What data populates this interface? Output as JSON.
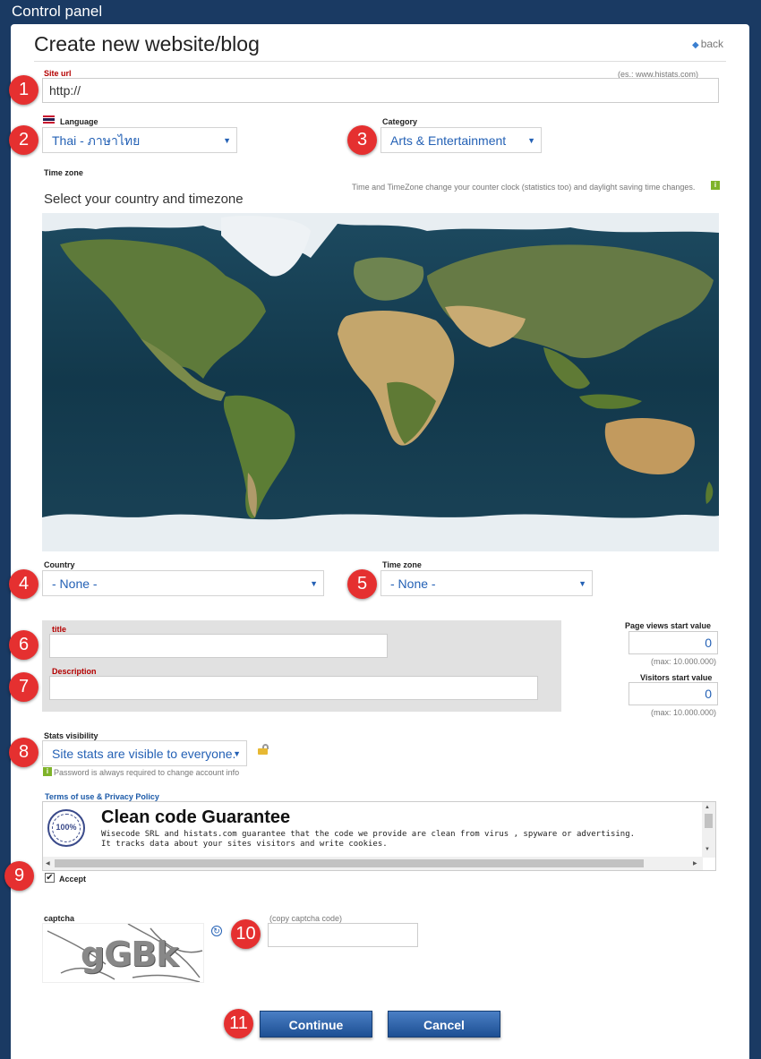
{
  "window": {
    "title": "Control panel"
  },
  "page": {
    "title": "Create new website/blog",
    "back_label": "back"
  },
  "site_url": {
    "label": "Site url",
    "example": "(es.: www.histats.com)",
    "value": "http://"
  },
  "language": {
    "label": "Language",
    "selected": "Thai - ภาษาไทย",
    "flag_icon": "thai-flag-icon"
  },
  "category": {
    "label": "Category",
    "selected": "Arts & Entertainment"
  },
  "timezone_section": {
    "label": "Time zone",
    "note": "Time and TimeZone change your counter clock (statistics too) and daylight saving time changes.",
    "heading": "Select your country and timezone"
  },
  "country": {
    "label": "Country",
    "selected": "- None -"
  },
  "time_zone": {
    "label": "Time zone",
    "selected": "- None -"
  },
  "title_field": {
    "label": "title",
    "value": ""
  },
  "description_field": {
    "label": "Description",
    "value": ""
  },
  "page_views": {
    "label": "Page views start value",
    "value": "0",
    "max": "(max: 10.000.000)"
  },
  "visitors": {
    "label": "Visitors start value",
    "value": "0",
    "max": "(max: 10.000.000)"
  },
  "stats_visibility": {
    "label": "Stats visibility",
    "selected": "Site stats are visible to everyone.",
    "note": "Password is always required to change account info",
    "lock_icon": "lock-icon"
  },
  "terms": {
    "label": "Terms of use & Privacy Policy",
    "heading": "Clean code Guarantee",
    "line1": "Wisecode SRL and histats.com guarantee that the code we provide are clean from virus , spyware or advertising.",
    "line2": "It tracks data about your sites visitors and write cookies.",
    "seal_text": "100%",
    "seal_ring_text": "GUARANTEE"
  },
  "accept": {
    "label": "Accept",
    "checked": true
  },
  "captcha": {
    "label": "captcha",
    "code_image_text": "gGBk",
    "hint": "(copy captcha code)",
    "value": ""
  },
  "buttons": {
    "continue": "Continue",
    "cancel": "Cancel"
  },
  "badges": [
    "1",
    "2",
    "3",
    "4",
    "5",
    "6",
    "7",
    "8",
    "9",
    "10",
    "11"
  ],
  "colors": {
    "background": "#1a3a63",
    "badge": "#e53030",
    "button": "#2a5ea6",
    "select_text": "#2461b5",
    "required_label": "#b40000"
  }
}
